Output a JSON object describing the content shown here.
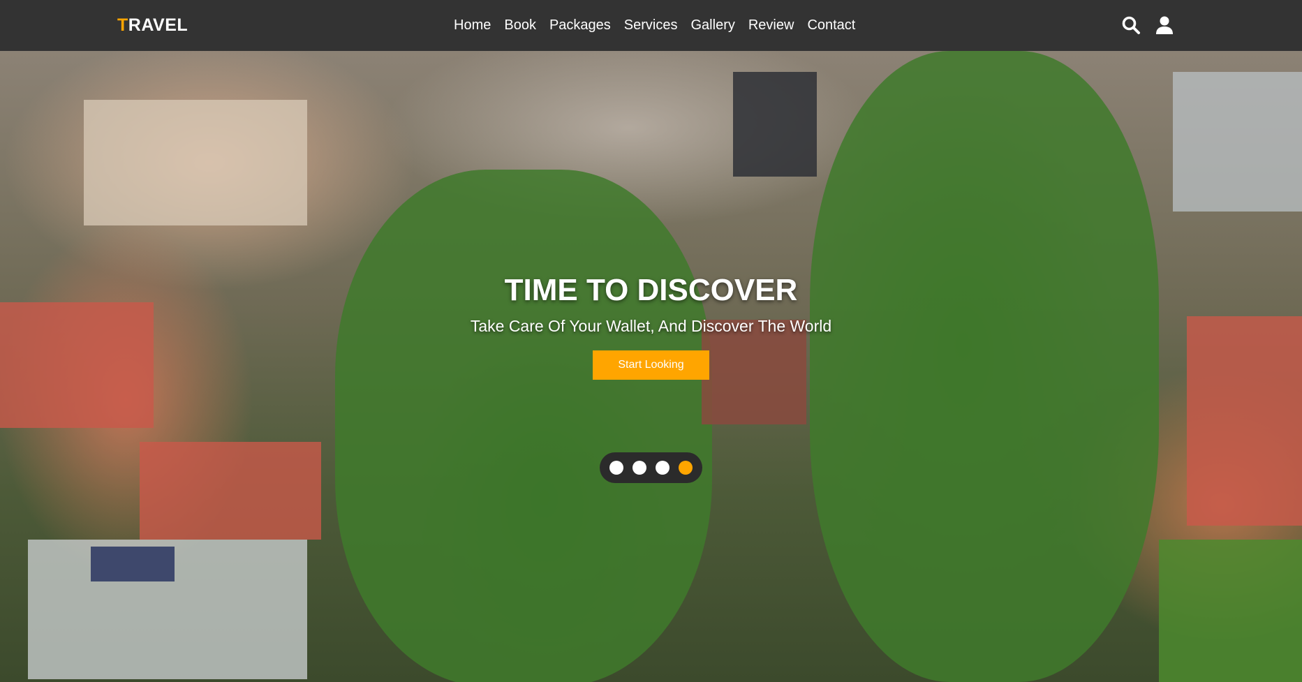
{
  "brand": {
    "first_letter": "T",
    "rest": "RAVEL",
    "accent_color": "#ffa500"
  },
  "nav": {
    "items": [
      {
        "label": "Home"
      },
      {
        "label": "Book"
      },
      {
        "label": "Packages"
      },
      {
        "label": "Services"
      },
      {
        "label": "Gallery"
      },
      {
        "label": "Review"
      },
      {
        "label": "Contact"
      }
    ]
  },
  "header_icons": [
    "search-icon",
    "user-icon"
  ],
  "hero": {
    "title": "TIME TO DISCOVER",
    "subtitle": "Take Care Of Your Wallet, And Discover The World",
    "cta_label": "Start Looking",
    "slider": {
      "count": 4,
      "active_index": 4
    }
  },
  "colors": {
    "header_bg": "#333333",
    "accent": "#ffa500",
    "dots_bg": "#2b2b2b"
  }
}
